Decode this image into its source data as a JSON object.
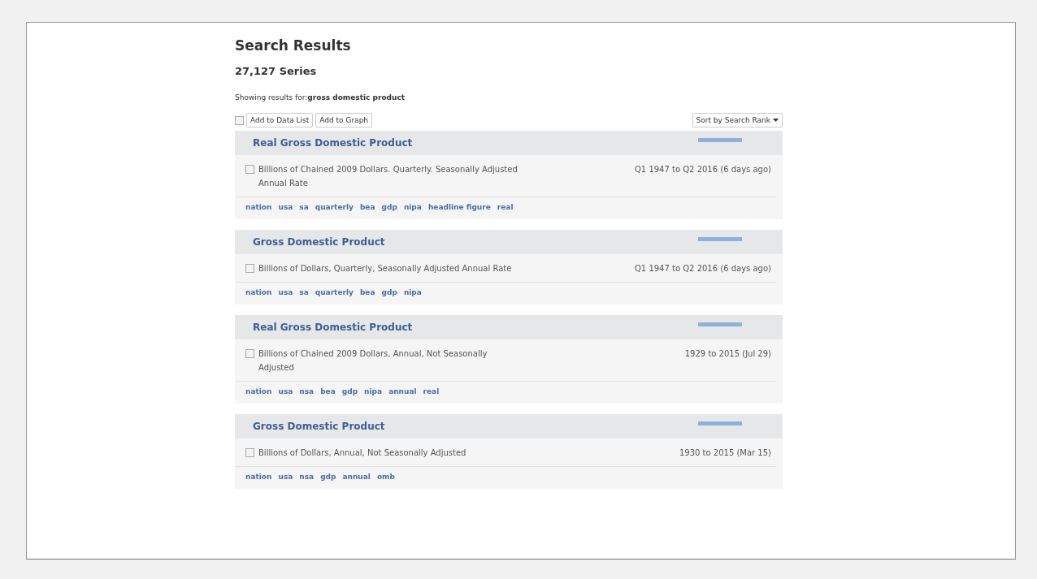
{
  "title": "Search Results",
  "count": "27,127 Series",
  "query": {
    "label": "Showing results for:",
    "term": "gross domestic product"
  },
  "toolbar": {
    "select_all": {
      "checked": false
    },
    "buttons": [
      "Add to Data List",
      "Add to Graph"
    ],
    "sort": "Sort by Search Rank"
  },
  "results": [
    {
      "title": "Real Gross Domestic Product",
      "checked": false,
      "description": "Billions of Chained 2009 Dollars. Quarterly. Seasonally Adjusted Annual Rate",
      "range": "Q1 1947 to Q2 2016 (6 days ago)",
      "tags": [
        "nation",
        "usa",
        "sa",
        "quarterly",
        "bea",
        "gdp",
        "nipa",
        "headline figure",
        "real"
      ]
    },
    {
      "title": "Gross Domestic Product",
      "checked": false,
      "description": "Billions of Dollars, Quarterly, Seasonally Adjusted Annual Rate",
      "range": "Q1 1947 to Q2 2016 (6 days ago)",
      "tags": [
        "nation",
        "usa",
        "sa",
        "quarterly",
        "bea",
        "gdp",
        "nipa"
      ]
    },
    {
      "title": "Real Gross Domestic Product",
      "checked": false,
      "description": "Billions of Chained 2009 Dollars, Annual, Not Seasonally Adjusted",
      "range": "1929 to 2015 (Jul 29)",
      "tags": [
        "nation",
        "usa",
        "nsa",
        "bea",
        "gdp",
        "nipa",
        "annual",
        "real"
      ]
    },
    {
      "title": "Gross Domestic Product",
      "checked": false,
      "description": "Billions of Dollars, Annual, Not Seasonally Adjusted",
      "range": "1930 to 2015 (Mar 15)",
      "tags": [
        "nation",
        "usa",
        "nsa",
        "gdp",
        "annual",
        "omb"
      ]
    }
  ]
}
